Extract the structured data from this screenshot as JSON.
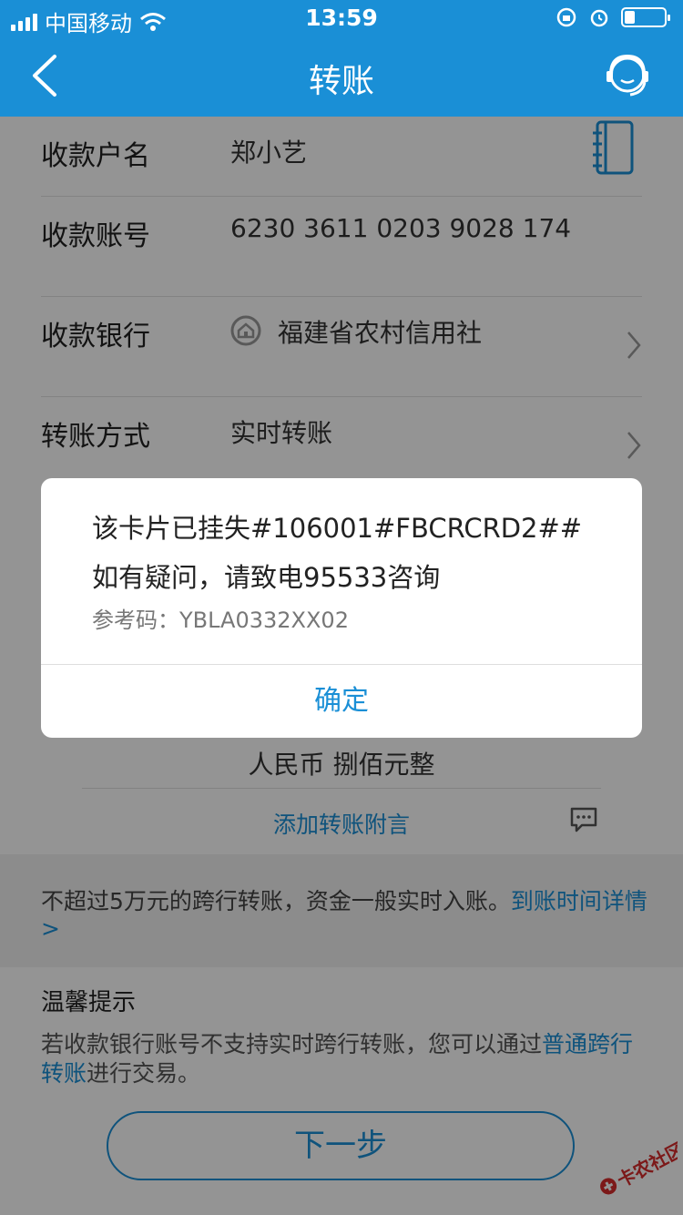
{
  "statusbar": {
    "carrier": "中国移动",
    "time": "13:59",
    "battery_level": 0.25
  },
  "nav": {
    "title": "转账"
  },
  "form": {
    "payee_label": "收款户名",
    "payee_value": "郑小艺",
    "account_label": "收款账号",
    "account_value": "6230 3611 0203 9028 174",
    "bank_label": "收款银行",
    "bank_value": "福建省农村信用社",
    "method_label": "转账方式",
    "method_value": "实时转账"
  },
  "amount": {
    "text": "人民币 捌佰元整",
    "add_note": "添加转账附言"
  },
  "notice": {
    "text": "不超过5万元的跨行转账，资金一般实时入账。",
    "link": "到账时间详情 >"
  },
  "tips": {
    "title": "温馨提示",
    "text_before": "若收款银行账号不支持实时跨行转账，您可以通过",
    "link": "普通跨行转账",
    "text_after": "进行交易。"
  },
  "next_button": "下一步",
  "dialog": {
    "line1": "该卡片已挂失#106001#FBCRCRD2##",
    "line2": "如有疑问，请致电95533咨询",
    "ref": "参考码：YBLA0332XX02",
    "ok": "确定"
  },
  "watermark": "卡农社区",
  "colors": {
    "accent": "#1a8fd6",
    "overlay": "rgba(0,0,0,0.42)"
  }
}
